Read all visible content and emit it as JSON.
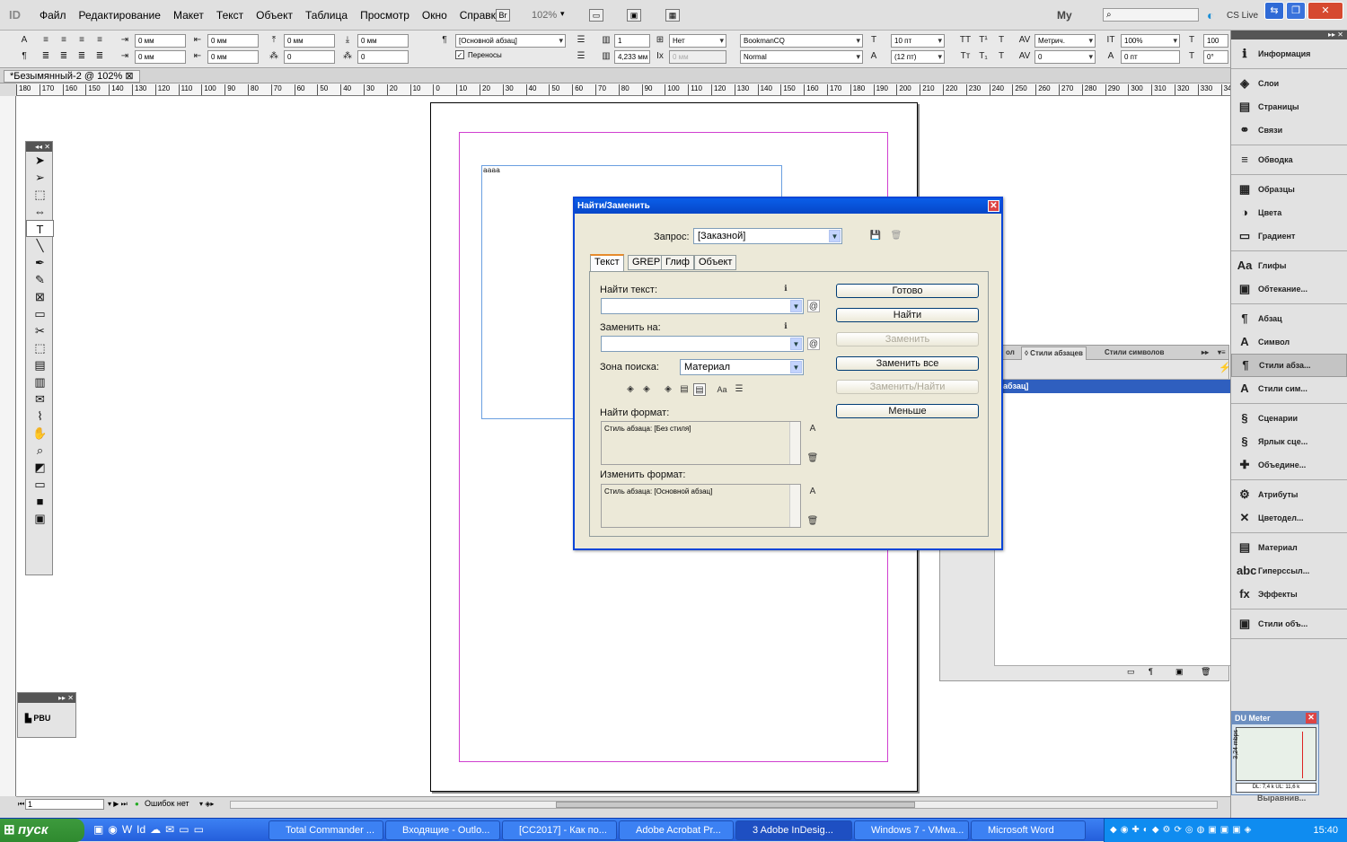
{
  "app": {
    "logo": "ID",
    "zoom": "102%",
    "workspace": "My",
    "cs_live": "CS Live"
  },
  "menubar": {
    "items": [
      "Файл",
      "Редактирование",
      "Макет",
      "Текст",
      "Объект",
      "Таблица",
      "Просмотр",
      "Окно",
      "Справка"
    ],
    "br_label": "Br"
  },
  "control": {
    "f1": "0 мм",
    "f2": "0 мм",
    "f3": "0 мм",
    "f4": "0 мм",
    "f5": "0 мм",
    "f6": "0 мм",
    "f7": "0",
    "f8": "0",
    "para_style": "[Основной абзац]",
    "hyphen_label": "Переносы",
    "columns": "1",
    "columns2": "4,233 мм",
    "none": "Нет",
    "dim": "0 мм",
    "font": "BookmanCQ",
    "font_style": "Normal",
    "size": "10 пт",
    "leading": "(12 пт)",
    "kern": "Метрич.",
    "track": "0",
    "scale": "100%",
    "baseline": "0 пт",
    "extra1": "100",
    "extra2": "0°"
  },
  "doctab": {
    "title": "*Безымянный-2 @ 102%"
  },
  "ruler": {
    "ticks": [
      "180",
      "170",
      "160",
      "150",
      "140",
      "130",
      "120",
      "110",
      "100",
      "90",
      "80",
      "70",
      "60",
      "50",
      "40",
      "30",
      "20",
      "10",
      "0",
      "10",
      "20",
      "30",
      "40",
      "50",
      "60",
      "70",
      "80",
      "90",
      "100",
      "110",
      "120",
      "130",
      "140",
      "150",
      "160",
      "170",
      "180",
      "190",
      "200",
      "210",
      "220",
      "230",
      "240",
      "250",
      "260",
      "270",
      "280",
      "290",
      "300",
      "310",
      "320",
      "330",
      "340"
    ]
  },
  "document": {
    "frame_text": "аааа"
  },
  "dialog": {
    "title": "Найти/Заменить",
    "query_label": "Запрос:",
    "query_value": "[Заказной]",
    "tabs": [
      "Текст",
      "GREP",
      "Глиф",
      "Объект"
    ],
    "find_label": "Найти текст:",
    "replace_label": "Заменить на:",
    "search_zone_label": "Зона поиска:",
    "search_zone_value": "Материал",
    "find_format_label": "Найти формат:",
    "find_format_value": "Стиль абзаца: [Без стиля]",
    "change_format_label": "Изменить формат:",
    "change_format_value": "Стиль абзаца: [Основной абзац]",
    "buttons": {
      "done": "Готово",
      "find": "Найти",
      "replace": "Заменить",
      "replace_all": "Заменить все",
      "replace_find": "Заменить/Найти",
      "less": "Меньше"
    },
    "case_icon": "Aa"
  },
  "pstyles": {
    "tab1": "ол",
    "tab2": "◊ Стили абзацев",
    "tab3": "Стили символов",
    "selected": "й абзац]"
  },
  "dock": {
    "groups": [
      [
        {
          "icon": "info-icon",
          "glyph": "ℹ",
          "label": "Информация"
        }
      ],
      [
        {
          "icon": "layers-icon",
          "glyph": "◈",
          "label": "Слои"
        },
        {
          "icon": "pages-icon",
          "glyph": "▤",
          "label": "Страницы"
        },
        {
          "icon": "links-icon",
          "glyph": "⚭",
          "label": "Связи"
        }
      ],
      [
        {
          "icon": "stroke-icon",
          "glyph": "≡",
          "label": "Обводка"
        }
      ],
      [
        {
          "icon": "swatches-icon",
          "glyph": "▦",
          "label": "Образцы"
        },
        {
          "icon": "colors-icon",
          "glyph": "◑",
          "label": "Цвета"
        },
        {
          "icon": "gradient-icon",
          "glyph": "▭",
          "label": "Градиент"
        }
      ],
      [
        {
          "icon": "glyphs-icon",
          "glyph": "Aa",
          "label": "Глифы"
        },
        {
          "icon": "text-wrap-icon",
          "glyph": "▣",
          "label": "Обтекание..."
        }
      ],
      [
        {
          "icon": "paragraph-icon",
          "glyph": "¶",
          "label": "Абзац"
        },
        {
          "icon": "character-icon",
          "glyph": "A",
          "label": "Символ"
        },
        {
          "icon": "paragraph-styles-icon",
          "glyph": "¶",
          "label": "Стили абза...",
          "sel": true
        },
        {
          "icon": "character-styles-icon",
          "glyph": "A",
          "label": "Стили сим..."
        }
      ],
      [
        {
          "icon": "scripts-icon",
          "glyph": "§",
          "label": "Сценарии"
        },
        {
          "icon": "script-label-icon",
          "glyph": "§",
          "label": "Ярлык сце..."
        },
        {
          "icon": "data-merge-icon",
          "glyph": "✚",
          "label": "Объедине..."
        }
      ],
      [
        {
          "icon": "attributes-icon",
          "glyph": "⚙",
          "label": "Атрибуты"
        },
        {
          "icon": "separations-icon",
          "glyph": "✕",
          "label": "Цветодел..."
        }
      ],
      [
        {
          "icon": "story-icon",
          "glyph": "▤",
          "label": "Материал"
        },
        {
          "icon": "hyperlinks-icon",
          "glyph": "abc",
          "label": "Гиперссыл..."
        },
        {
          "icon": "effects-icon",
          "glyph": "fx",
          "label": "Эффекты"
        }
      ],
      [
        {
          "icon": "object-styles-icon",
          "glyph": "▣",
          "label": "Стили объ..."
        }
      ]
    ]
  },
  "status": {
    "page": "1",
    "errors": "Ошибок нет"
  },
  "pbu": {
    "label": "PBU"
  },
  "dumeter": {
    "title": "DU Meter",
    "scale": "3,24 mbps",
    "readout": "DL: 7,4 k  UL: 11,6 k",
    "under": "Выравнив..."
  },
  "taskbar": {
    "start": "пуск",
    "tasks": [
      "Total Commander ...",
      "Входящие - Outlo...",
      "[CC2017] - Как по...",
      "Adobe Acrobat Pr...",
      "3 Adobe InDesig...",
      "Windows 7 - VMwa...",
      "Microsoft Word"
    ],
    "clock": "15:40"
  }
}
